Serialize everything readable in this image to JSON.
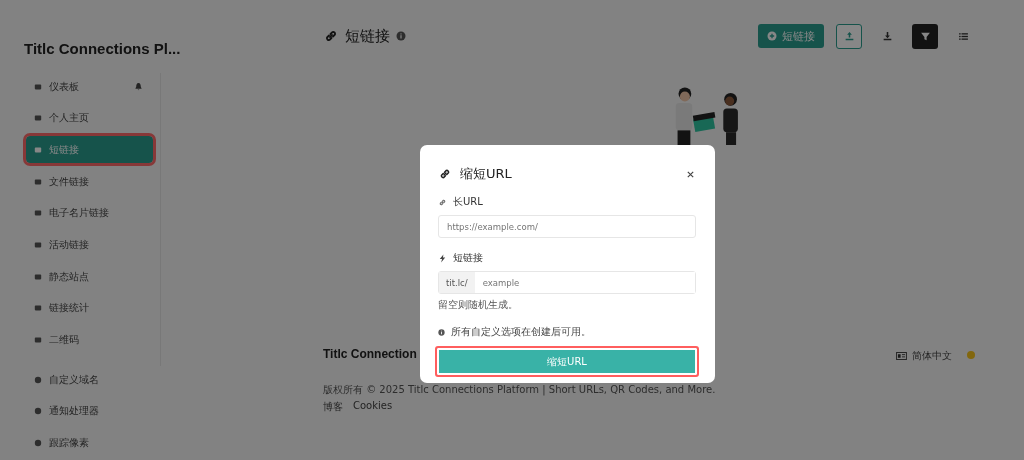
{
  "sidebar": {
    "title": "Titlc Connections Pl...",
    "items": [
      {
        "label": "仪表板",
        "selected": false,
        "highlighted": false,
        "bell": true
      },
      {
        "label": "个人主页",
        "selected": false,
        "highlighted": false,
        "bell": false
      },
      {
        "label": "短链接",
        "selected": true,
        "highlighted": true,
        "bell": false
      },
      {
        "label": "文件链接",
        "selected": false,
        "highlighted": false,
        "bell": false
      },
      {
        "label": "电子名片链接",
        "selected": false,
        "highlighted": false,
        "bell": false
      },
      {
        "label": "活动链接",
        "selected": false,
        "highlighted": false,
        "bell": false
      },
      {
        "label": "静态站点",
        "selected": false,
        "highlighted": false,
        "bell": false
      },
      {
        "label": "链接统计",
        "selected": false,
        "highlighted": false,
        "bell": false
      },
      {
        "label": "二维码",
        "selected": false,
        "highlighted": false,
        "bell": false
      }
    ],
    "bottom_items": [
      {
        "label": "自定义域名",
        "selected": false
      },
      {
        "label": "通知处理器",
        "selected": false
      },
      {
        "label": "跟踪像素",
        "selected": false
      }
    ]
  },
  "header": {
    "title": "短链接",
    "new_button": "短链接"
  },
  "footer": {
    "title": "Titlc Connection",
    "copyright": "版权所有 © 2025 Titlc Connections Platform | Short URLs, QR Codes, and More.",
    "links": [
      "博客",
      "Cookies"
    ],
    "language": "简体中文"
  },
  "modal": {
    "title": "缩短URL",
    "long_url": {
      "label": "长URL",
      "placeholder": "https://example.com/"
    },
    "short_link": {
      "label": "短链接",
      "prefix": "tit.lc/",
      "placeholder": "example",
      "help": "留空则随机生成。"
    },
    "note": "所有自定义选项在创建后可用。",
    "submit": {
      "label": "缩短URL",
      "highlighted": true
    }
  }
}
